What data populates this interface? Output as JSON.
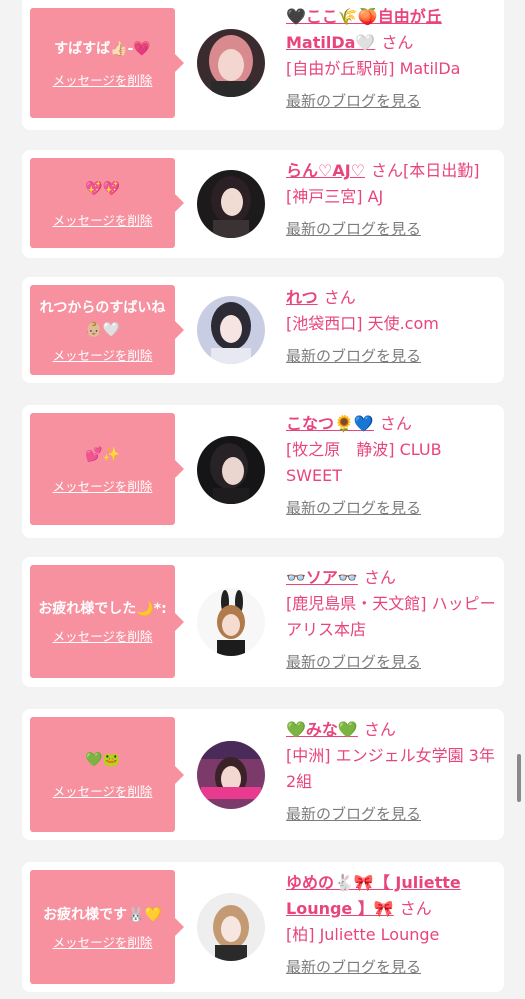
{
  "colors": {
    "bubble": "#f7919f",
    "name": "#e8447e",
    "blog_link": "#7c7c7c",
    "background": "#f3f3f3"
  },
  "entries": [
    {
      "message": "すばすば👍🏻-💗",
      "delete_label": "メッセージを削除",
      "name": "🖤ここ🌾🍑自由が丘 MatilDa🤍",
      "suffix": "さん",
      "shop": "[自由が丘駅前] MatilDa",
      "blog_label": "最新のブログを見る",
      "avatar": "avatar-photo"
    },
    {
      "message": "💖💖",
      "delete_label": "メッセージを削除",
      "name": "らん♡AJ♡",
      "suffix": "さん[本日出勤]",
      "shop": "[神戸三宮] AJ",
      "blog_label": "最新のブログを見る",
      "avatar": "avatar-photo"
    },
    {
      "message": "れつからのすばいね👶🏼🤍",
      "delete_label": "メッセージを削除",
      "name": "れつ",
      "suffix": "さん",
      "shop": "[池袋西口] 天使.com",
      "blog_label": "最新のブログを見る",
      "avatar": "avatar-photo"
    },
    {
      "message": "💕✨",
      "delete_label": "メッセージを削除",
      "name": "こなつ🌻💙",
      "suffix": "さん",
      "shop": "[牧之原　静波] CLUB SWEET",
      "blog_label": "最新のブログを見る",
      "avatar": "avatar-photo"
    },
    {
      "message": "お疲れ様でした🌙*:",
      "delete_label": "メッセージを削除",
      "name": "👓ソア👓",
      "suffix": "さん",
      "shop": "[鹿児島県・天文館] ハッピーアリス本店",
      "blog_label": "最新のブログを見る",
      "avatar": "avatar-photo"
    },
    {
      "message": "💚🐸",
      "delete_label": "メッセージを削除",
      "name": "💚みな💚",
      "suffix": "さん",
      "shop": "[中洲] エンジェル女学園 3年2組",
      "blog_label": "最新のブログを見る",
      "avatar": "avatar-photo"
    },
    {
      "message": "お疲れ様です🐰💛",
      "delete_label": "メッセージを削除",
      "name": "ゆめの🐇🎀【 Juliette Lounge 】🎀",
      "suffix": "さん",
      "shop": "[柏] Juliette Lounge",
      "blog_label": "最新のブログを見る",
      "avatar": "avatar-photo"
    }
  ]
}
